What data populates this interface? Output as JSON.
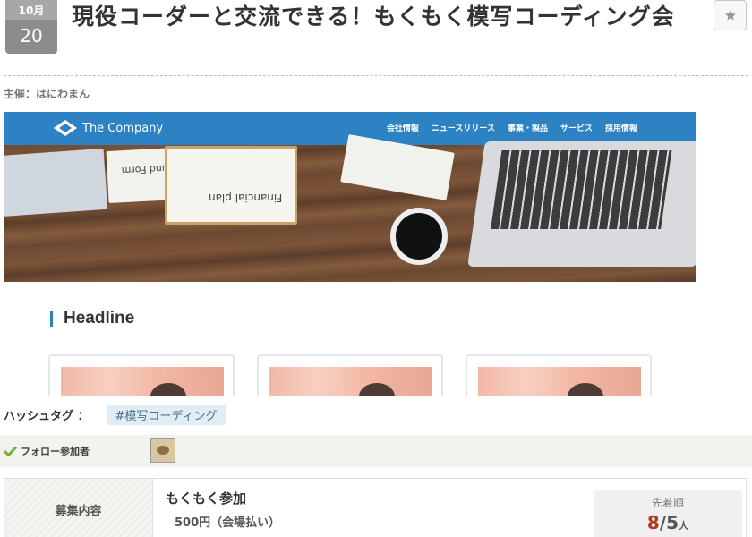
{
  "event": {
    "month": "10月",
    "day": "20",
    "title": "現役コーダーと交流できる！もくもく模写コーディング会",
    "organizer": "主催：はにわまん"
  },
  "banner": {
    "brand": "The Company",
    "nav": [
      "会社情報",
      "ニュースリリース",
      "事業・製品",
      "サービス",
      "採用情報"
    ],
    "paper_left": "Tax Refund Form",
    "paper_center": "Financial plan",
    "headline": "Headline"
  },
  "hashtags": {
    "label": "ハッシュタグ ：",
    "tag": "#模写コーディング"
  },
  "followers": {
    "label": "フォロー参加者"
  },
  "recruit": {
    "header": "募集内容",
    "plan_title": "もくもく参加",
    "price": "500円（会場払い）",
    "capacity_label": "先着順",
    "current": "8",
    "separator": "/",
    "limit": "5",
    "unit": "人"
  },
  "colors": {
    "brand_blue": "#2d82c4",
    "date_badge": "#8c8c8c",
    "count_red": "#b23b1c",
    "check_green": "#6fb43f"
  },
  "icons": {
    "favorite": "star-icon",
    "follow": "check-icon"
  }
}
